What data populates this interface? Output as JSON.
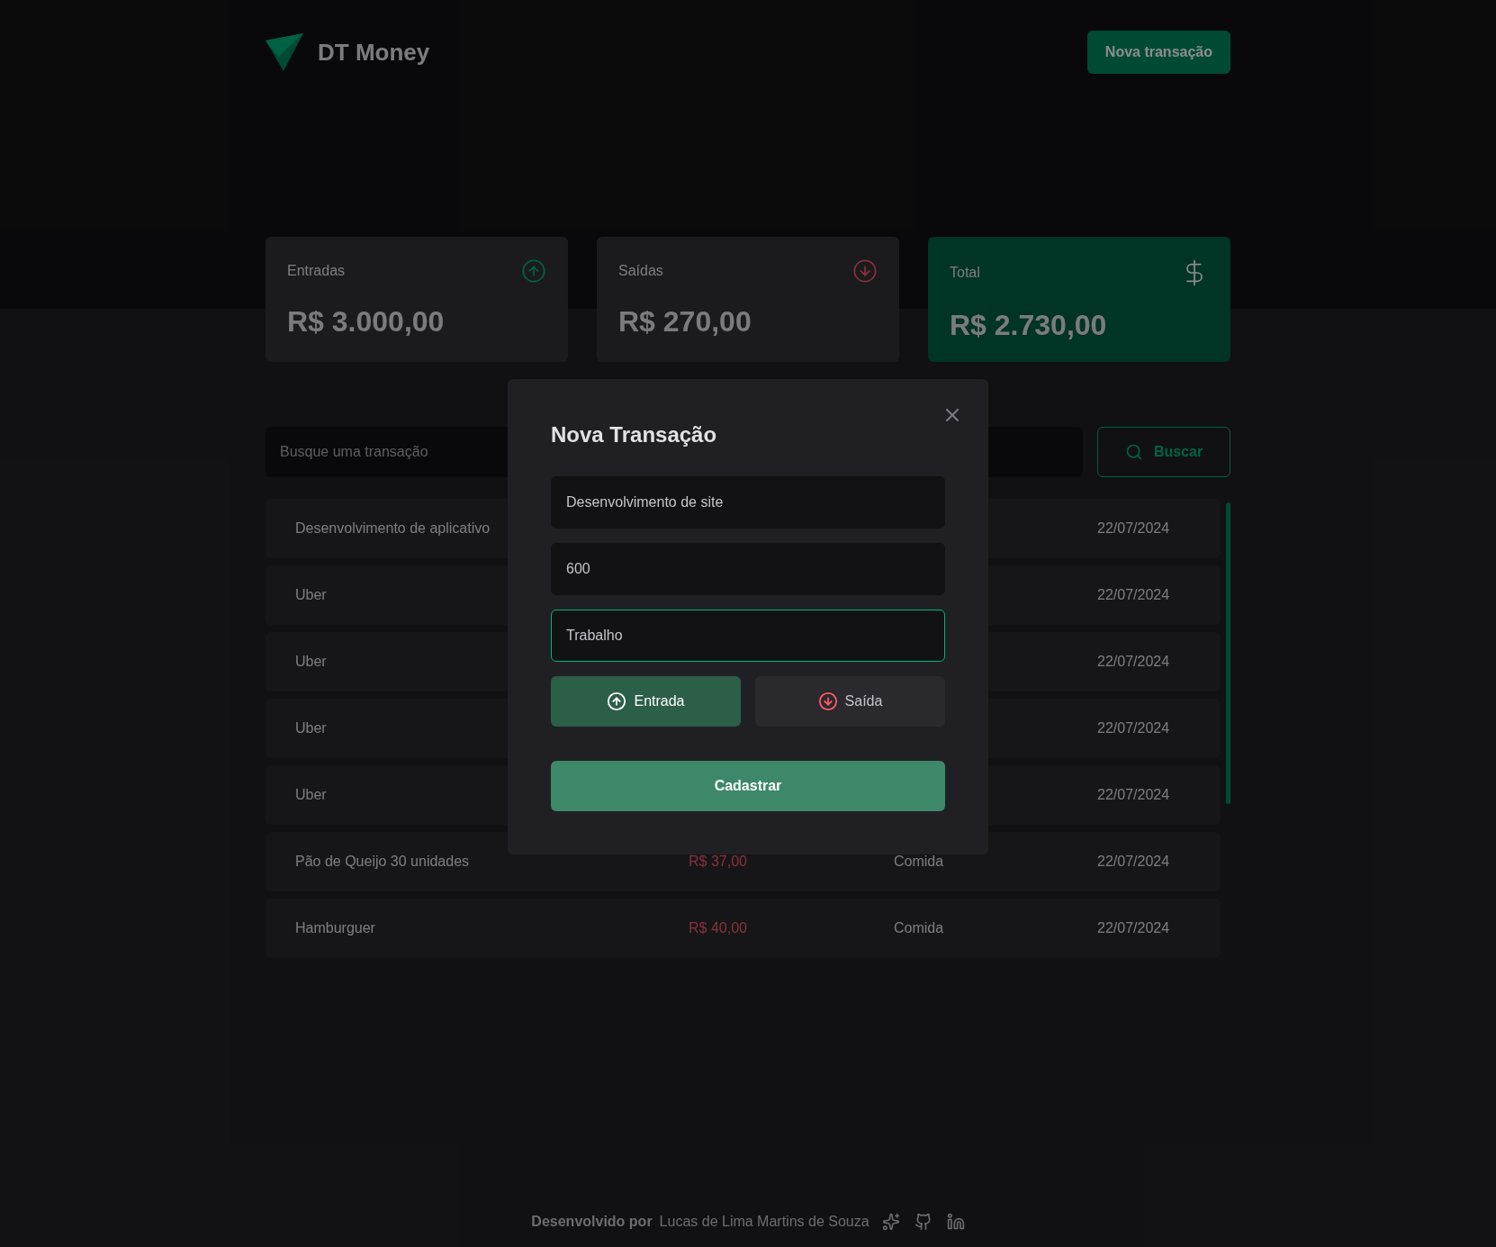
{
  "header": {
    "brand": "DT Money",
    "new_button": "Nova transação"
  },
  "summary": [
    {
      "kind": "income",
      "label": "Entradas",
      "value": "R$ 3.000,00"
    },
    {
      "kind": "outcome",
      "label": "Saídas",
      "value": "R$ 270,00"
    },
    {
      "kind": "total",
      "label": "Total",
      "value": "R$ 2.730,00"
    }
  ],
  "search": {
    "placeholder": "Busque uma transação",
    "button": "Buscar"
  },
  "transactions": [
    {
      "description": "Desenvolvimento de aplicativo",
      "date": "22/07/2024"
    },
    {
      "description": "Uber",
      "date": "22/07/2024"
    },
    {
      "description": "Uber",
      "date": "22/07/2024"
    },
    {
      "description": "Uber",
      "date": "22/07/2024"
    },
    {
      "description": "Uber",
      "date": "22/07/2024"
    },
    {
      "description": "Pão de Queijo 30 unidades",
      "price": "R$ 37,00",
      "kind": "outcome",
      "category": "Comida",
      "date": "22/07/2024"
    },
    {
      "description": "Hamburguer",
      "price": "R$ 40,00",
      "kind": "outcome",
      "category": "Comida",
      "date": "22/07/2024"
    }
  ],
  "footer": {
    "prefix": "Desenvolvido por",
    "author": "Lucas de Lima Martins de Souza"
  },
  "modal": {
    "title": "Nova Transação",
    "fields": [
      {
        "value": "Desenvolvimento de site",
        "focused": false
      },
      {
        "value": "600",
        "focused": false
      },
      {
        "value": "Trabalho",
        "focused": true
      }
    ],
    "types": [
      {
        "kind": "income",
        "label": "Entrada",
        "selected": true
      },
      {
        "kind": "outcome",
        "label": "Saída",
        "selected": false
      }
    ],
    "submit": "Cadastrar"
  }
}
